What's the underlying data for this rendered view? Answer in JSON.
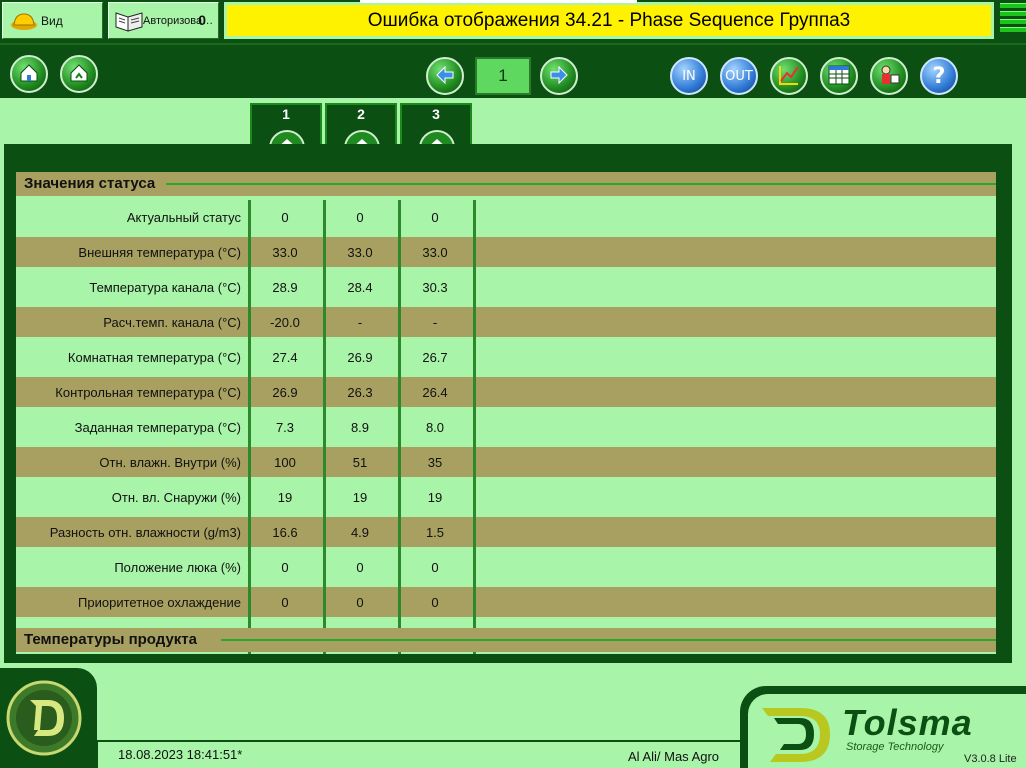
{
  "top": {
    "view_label": "Вид",
    "login_label": "Авторизова…",
    "login_count": "0",
    "title": "Ошибка отображения 34.21 - Phase Sequence Группа3"
  },
  "toolbar": {
    "page_number": "1",
    "in_label": "IN",
    "out_label": "OUT"
  },
  "groups": [
    "1",
    "2",
    "3"
  ],
  "sections": {
    "status": "Значения статуса",
    "product_temps": "Температуры продукта"
  },
  "rows": [
    {
      "label": "Актуальный статус",
      "v": [
        "0",
        "0",
        "0"
      ]
    },
    {
      "label": "Внешняя температура (°C)",
      "v": [
        "33.0",
        "33.0",
        "33.0"
      ]
    },
    {
      "label": "Температура канала (°C)",
      "v": [
        "28.9",
        "28.4",
        "30.3"
      ]
    },
    {
      "label": "Расч.темп. канала (°C)",
      "v": [
        "-20.0",
        "-",
        "-"
      ]
    },
    {
      "label": "Комнатная температура (°C)",
      "v": [
        "27.4",
        "26.9",
        "26.7"
      ]
    },
    {
      "label": "Контрольная температура (°C)",
      "v": [
        "26.9",
        "26.3",
        "26.4"
      ]
    },
    {
      "label": "Заданная  температура (°C)",
      "v": [
        "7.3",
        "8.9",
        "8.0"
      ]
    },
    {
      "label": "Отн. влажн. Внутри (%)",
      "v": [
        "100",
        "51",
        "35"
      ]
    },
    {
      "label": "Отн. вл. Снаружи (%)",
      "v": [
        "19",
        "19",
        "19"
      ]
    },
    {
      "label": "Разность отн. влажности (g/m3)",
      "v": [
        "16.6",
        "4.9",
        "1.5"
      ]
    },
    {
      "label": "Положение люка (%)",
      "v": [
        "0",
        "0",
        "0"
      ]
    },
    {
      "label": "Приоритетное охлаждение",
      "v": [
        "0",
        "0",
        "0"
      ]
    }
  ],
  "footer": {
    "datetime": "18.08.2023 18:41:51*",
    "site": "Al Ali/ Mas Agro",
    "brand": "Tolsma",
    "brand_sub": "Storage Technology",
    "version": "V3.0.8 Lite"
  },
  "colors": {
    "dark_green": "#0b4f12",
    "light_green": "#a8f4a8",
    "olive_row": "#a8a060",
    "title_yellow": "#fff200"
  },
  "icons": [
    "helmet-icon",
    "login-book-icon",
    "home-icon",
    "home-up-icon",
    "arrow-left-icon",
    "arrow-right-icon",
    "chart-icon",
    "table-icon",
    "tools-icon",
    "help-icon",
    "group-home-icon",
    "tolsma-logo-icon"
  ]
}
